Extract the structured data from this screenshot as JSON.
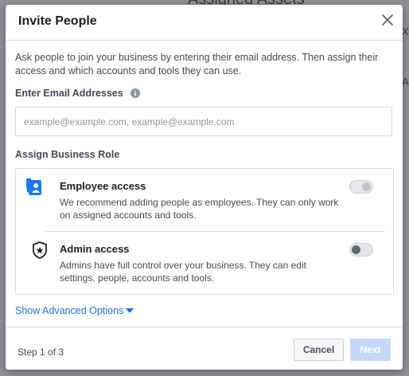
{
  "background": {
    "title_fragment": "Assigned Assets",
    "right_edge_fragments": [
      "X",
      "A"
    ]
  },
  "dialog": {
    "title": "Invite People",
    "close_icon": "close-icon",
    "intro_text": "Ask people to join your business by entering their email address. Then assign their access and which accounts and tools they can use.",
    "email_label": "Enter Email Addresses",
    "email_info_icon": "info-icon",
    "email_placeholder": "example@example.com, example@example.com",
    "email_value": "",
    "role_label": "Assign Business Role",
    "roles": [
      {
        "name": "Employee access",
        "description": "We recommend adding people as employees. They can only work on assigned accounts and tools.",
        "icon": "employee-badge-icon",
        "toggle_on": false,
        "toggle_disabled": true
      },
      {
        "name": "Admin access",
        "description": "Admins have full control over your business. They can edit settings, people, accounts and tools.",
        "icon": "admin-shield-icon",
        "toggle_on": false,
        "toggle_disabled": false
      }
    ],
    "advanced_options_label": "Show Advanced Options",
    "footer": {
      "step_text": "Step 1 of 3",
      "cancel_label": "Cancel",
      "next_label": "Next"
    }
  },
  "colors": {
    "accent": "#216fdb",
    "next_disabled": "#c4d9f7",
    "overlay": "#8e9094"
  }
}
